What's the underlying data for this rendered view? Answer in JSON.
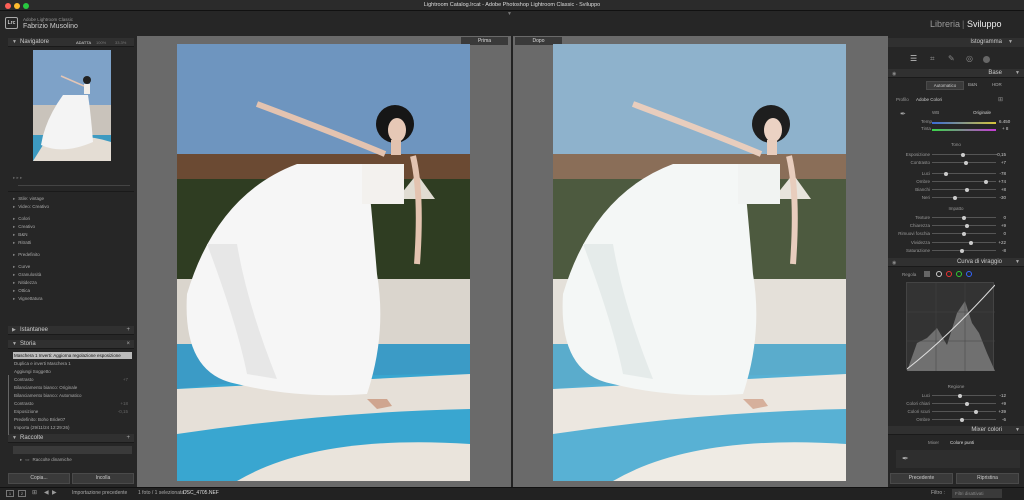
{
  "window": {
    "title": "Lightroom Catalog.lrcat - Adobe Photoshop Lightroom Classic - Sviluppo"
  },
  "header": {
    "logo_text": "Lrc",
    "app_name": "Adobe Lightroom Classic",
    "user_name": "Fabrizio Musolino",
    "modules": [
      "Libreria",
      "Sviluppo"
    ],
    "module_sep": "|"
  },
  "left": {
    "navigator_title": "Navigatore",
    "nav_zoom": [
      "ADATTA",
      "100%",
      "33.3%"
    ],
    "presets_items": [
      "Stile: vintage",
      "Video: Creativo",
      "",
      "Colori",
      "Creativo",
      "B&N",
      "Ritratti",
      "",
      "Predefinito",
      "",
      "Curve",
      "Granulosità",
      "Nitidezza",
      "Ottica",
      "Vignettatura"
    ],
    "snapshots_title": "Istantanee",
    "history_title": "Storia",
    "history": [
      {
        "label": "Maschera 1 Inverti: Aggiorna regolazione esposizione",
        "v": ""
      },
      {
        "label": "Duplica e inverti Maschera 1",
        "v": ""
      },
      {
        "label": "Aggiungi Soggetto",
        "v": ""
      },
      {
        "label": "Contrasto",
        "v": "+7"
      },
      {
        "label": "Bilanciamento bianco: Originale",
        "v": ""
      },
      {
        "label": "Bilanciamento bianco: Automatico",
        "v": ""
      },
      {
        "label": "Contrasto",
        "v": "+18"
      },
      {
        "label": "Esposizione",
        "v": "-0,15"
      },
      {
        "label": "Predefinito: Boho Bride07",
        "v": ""
      },
      {
        "label": "Importa (29/11/24 12:29:26)",
        "v": ""
      }
    ],
    "collections_title": "Raccolte",
    "collection_item": "Raccolte dinamiche",
    "copy_btn": "Copia...",
    "paste_btn": "Incolla"
  },
  "center": {
    "before_label": "Prima",
    "after_label": "Dopo"
  },
  "right": {
    "histogram_title": "Istogramma",
    "basic_title": "Base",
    "treatment": [
      "Automatico",
      "B&N",
      "HDR"
    ],
    "profile_label": "Profilo",
    "profile_value": "Adobe Colori",
    "wb_label": "WB",
    "wb_value": "Originale",
    "temp_label": "Temp",
    "temp_value": "6.450",
    "tint_label": "Tinta",
    "tint_value": "+ 8",
    "tone_title": "Tono",
    "tone": [
      {
        "label": "Esposizione",
        "value": "-0,15",
        "pos": 0.48
      },
      {
        "label": "Contrasto",
        "value": "+7",
        "pos": 0.53
      }
    ],
    "tone2": [
      {
        "label": "Luci",
        "value": "-78",
        "pos": 0.2
      },
      {
        "label": "Ombre",
        "value": "+74",
        "pos": 0.87
      },
      {
        "label": "Bianchi",
        "value": "+8",
        "pos": 0.55
      },
      {
        "label": "Neri",
        "value": "-30",
        "pos": 0.35
      }
    ],
    "presence_title": "Impatto",
    "presence": [
      {
        "label": "Texture",
        "value": "0",
        "pos": 0.5
      },
      {
        "label": "Chiarezza",
        "value": "+9",
        "pos": 0.55
      },
      {
        "label": "Rimuovi foschia",
        "value": "0",
        "pos": 0.5
      }
    ],
    "presence2": [
      {
        "label": "Vividezza",
        "value": "+22",
        "pos": 0.61
      },
      {
        "label": "Saturazione",
        "value": "-8",
        "pos": 0.46
      }
    ],
    "curve_title": "Curva di viraggio",
    "curve_regolaz": "Regola",
    "region_title": "Regione",
    "region": [
      {
        "label": "Luci",
        "value": "-12",
        "pos": 0.44
      },
      {
        "label": "Colori chiari",
        "value": "+9",
        "pos": 0.55
      },
      {
        "label": "Colori scuri",
        "value": "+39",
        "pos": 0.7
      },
      {
        "label": "Ombre",
        "value": "-6",
        "pos": 0.47
      }
    ],
    "mixer_title": "Mixer colori",
    "mixer_tabs": [
      "Mixer",
      "Colore punti"
    ],
    "prev_btn": "Precedente",
    "reset_btn": "Ripristina"
  },
  "bottom": {
    "source": "Importazione precedente",
    "count": "1 foto / 1 selezionata /",
    "filename": "DSC_4705.NEF",
    "filter_label": "Filtro :",
    "filter_value": "Filtri disattivati"
  },
  "colors": {
    "sky_before": "#6e95bf",
    "sky_after": "#8eb2cc",
    "pool": "#3a98c0"
  }
}
